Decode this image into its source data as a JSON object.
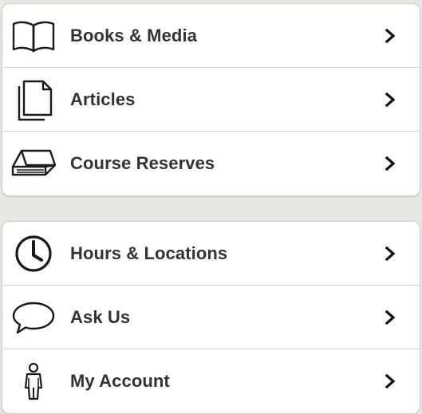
{
  "colors": {
    "background": "#e9e7e1",
    "card": "#ffffff",
    "divider": "#d3d3d3",
    "text": "#333333",
    "icon": "#1a1a1a"
  },
  "menu": {
    "group1": [
      {
        "label": "Books & Media",
        "icon": "open-book-icon"
      },
      {
        "label": "Articles",
        "icon": "documents-icon"
      },
      {
        "label": "Course Reserves",
        "icon": "closed-book-icon"
      }
    ],
    "group2": [
      {
        "label": "Hours & Locations",
        "icon": "clock-icon"
      },
      {
        "label": "Ask Us",
        "icon": "speech-bubble-icon"
      },
      {
        "label": "My Account",
        "icon": "person-icon"
      }
    ]
  }
}
